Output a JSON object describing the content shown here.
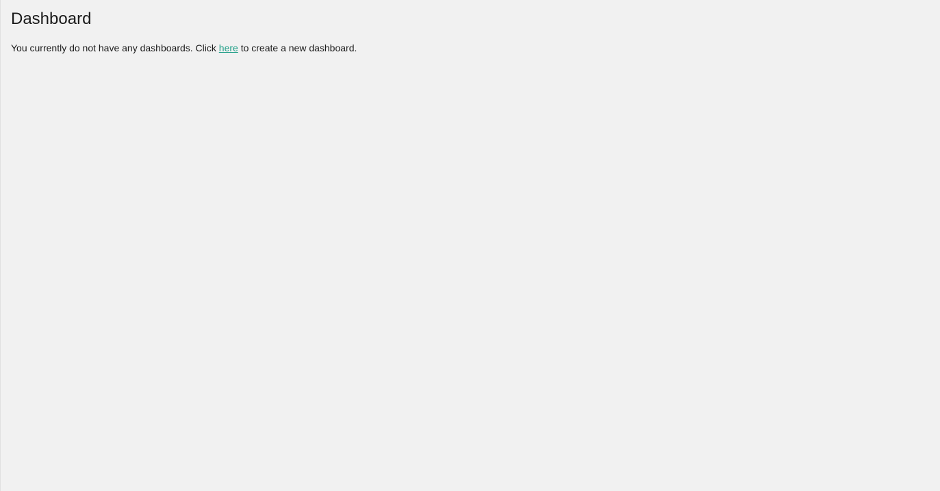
{
  "page": {
    "title": "Dashboard"
  },
  "empty_state": {
    "prefix": "You currently do not have any dashboards. Click ",
    "link_text": "here",
    "suffix": " to create a new dashboard."
  },
  "colors": {
    "background": "#f1f1f1",
    "text": "#1a1a1a",
    "link": "#1f9e87"
  }
}
